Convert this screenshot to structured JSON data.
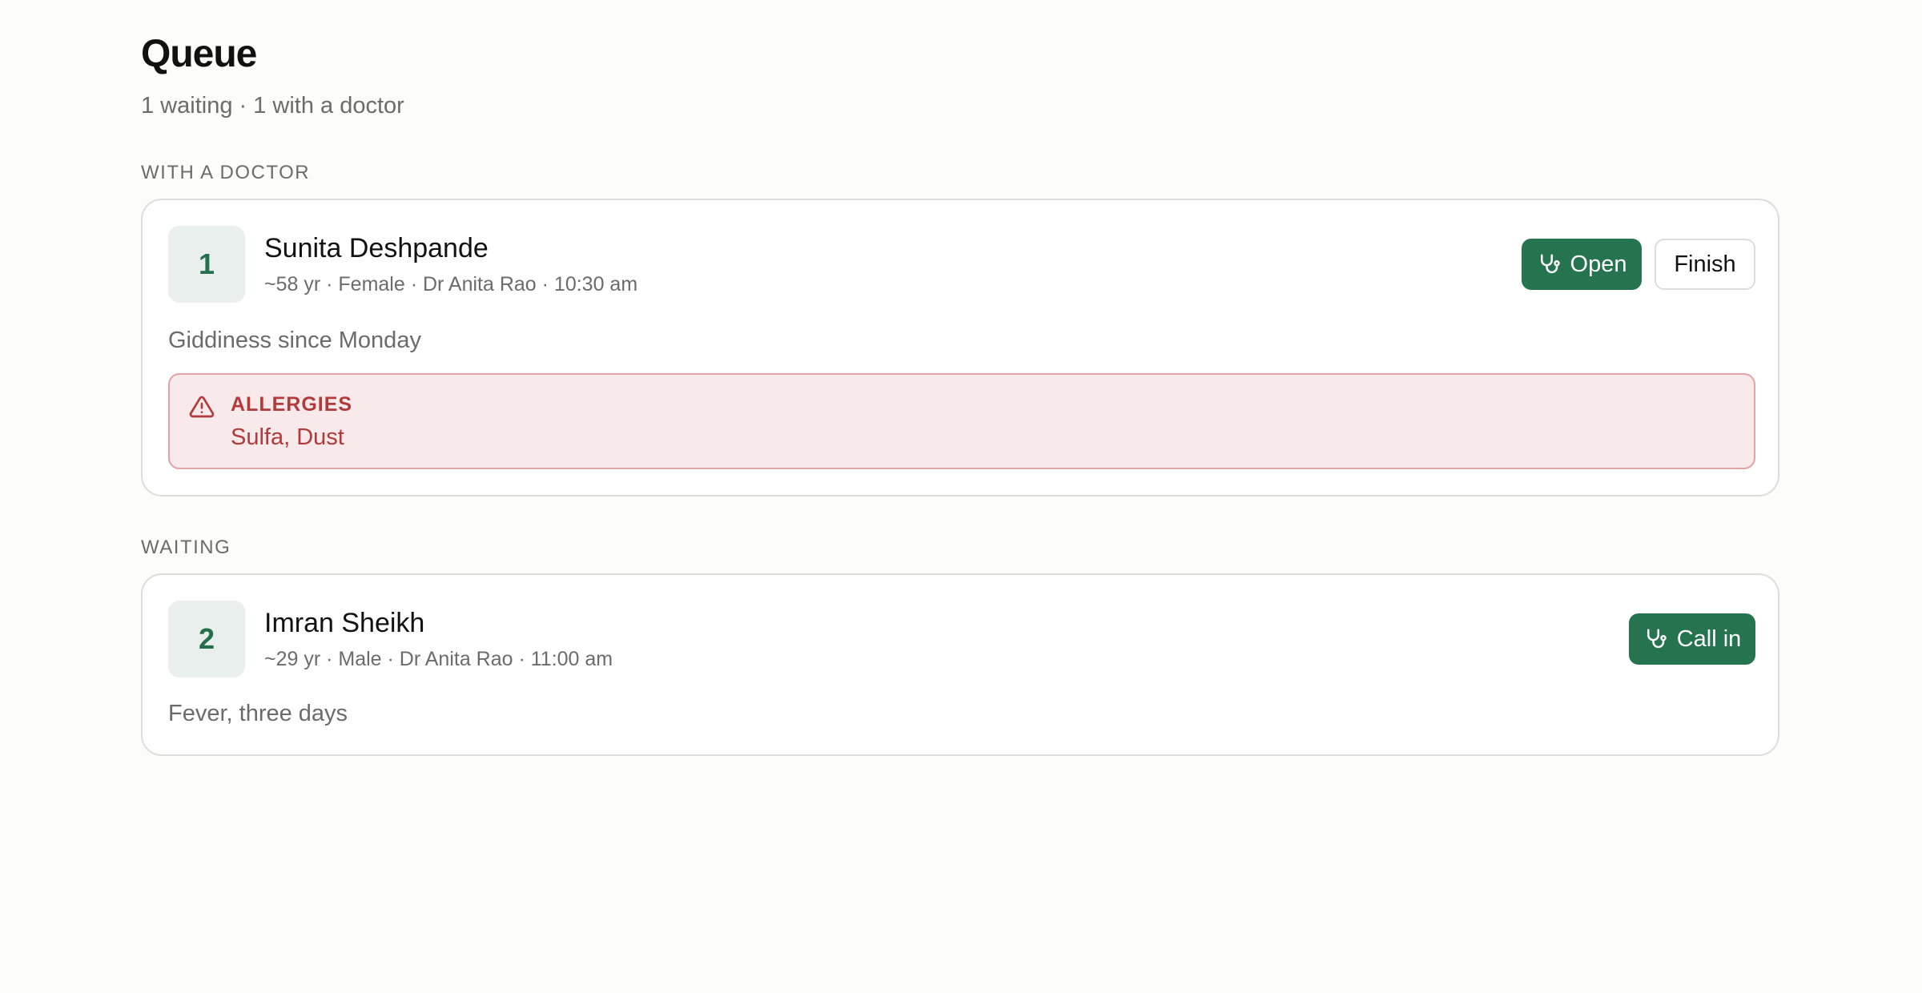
{
  "page": {
    "title": "Queue",
    "summary": "1 waiting · 1 with a doctor"
  },
  "sections": {
    "with_doctor": {
      "label": "WITH A DOCTOR",
      "patient": {
        "token": "1",
        "name": "Sunita Deshpande",
        "meta": "~58 yr · Female · Dr Anita Rao · 10:30 am",
        "complaint": "Giddiness since Monday",
        "open_label": "Open",
        "finish_label": "Finish",
        "allergies": {
          "title": "ALLERGIES",
          "value": "Sulfa, Dust"
        }
      }
    },
    "waiting": {
      "label": "WAITING",
      "patient": {
        "token": "2",
        "name": "Imran Sheikh",
        "meta": "~29 yr · Male · Dr Anita Rao · 11:00 am",
        "complaint": "Fever, three days",
        "call_in_label": "Call in"
      }
    }
  },
  "icons": {
    "action_icon": "stethoscope-icon",
    "alert_icon": "warning-triangle-icon"
  },
  "colors": {
    "primary": "#267350",
    "token_bg": "#e9efec",
    "alert_bg": "#f8e9ea",
    "alert_border": "#e2a3a5",
    "alert_text": "#b23a3a",
    "muted_text": "#6b6b6b"
  }
}
